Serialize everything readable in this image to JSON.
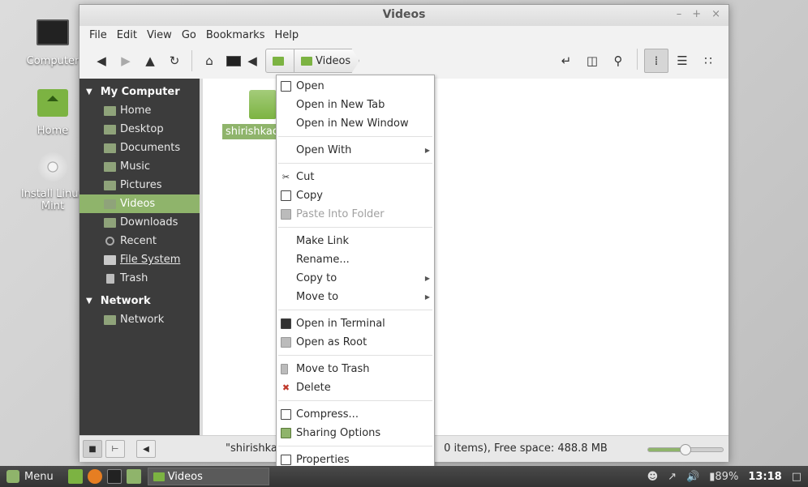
{
  "desktop": {
    "icons": [
      {
        "label": "Computer"
      },
      {
        "label": "Home"
      },
      {
        "label": "Install Linux Mint"
      }
    ]
  },
  "window": {
    "title": "Videos",
    "controls": [
      "–",
      "+",
      "×"
    ],
    "menu": [
      "File",
      "Edit",
      "View",
      "Go",
      "Bookmarks",
      "Help"
    ],
    "breadcrumb": {
      "current": "Videos"
    }
  },
  "sidebar": {
    "my_computer": "My Computer",
    "items": [
      "Home",
      "Desktop",
      "Documents",
      "Music",
      "Pictures",
      "Videos",
      "Downloads",
      "Recent",
      "File System",
      "Trash"
    ],
    "network_header": "Network",
    "network_items": [
      "Network"
    ],
    "selected": "Videos"
  },
  "content": {
    "file_label": "shirishkad"
  },
  "status": {
    "text": "\"shirishkad",
    "text_right": "0 items), Free space: 488.8 MB",
    "zoom_fraction": 0.5
  },
  "context_menu": {
    "items": [
      "Open",
      "Open in New Tab",
      "Open in New Window",
      "Open With",
      "Cut",
      "Copy",
      "Paste Into Folder",
      "Make Link",
      "Rename...",
      "Copy to",
      "Move to",
      "Open in Terminal",
      "Open as Root",
      "Move to Trash",
      "Delete",
      "Compress...",
      "Sharing Options",
      "Properties"
    ]
  },
  "taskbar": {
    "menu_label": "Menu",
    "window_label": "Videos",
    "battery": "89%",
    "clock": "13:18"
  },
  "colors": {
    "accent": "#8fb46b",
    "sidebar_bg": "#3c3c3c",
    "taskbar_bg": "#333333"
  }
}
